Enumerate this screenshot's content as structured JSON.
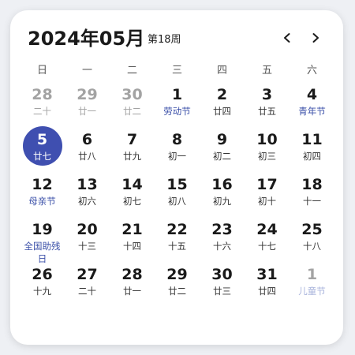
{
  "header": {
    "title": "2024年05月",
    "week": "第18周"
  },
  "weekdays": [
    "日",
    "一",
    "二",
    "三",
    "四",
    "五",
    "六"
  ],
  "weeks": [
    [
      {
        "day": "28",
        "lunar": "二十",
        "other": true
      },
      {
        "day": "29",
        "lunar": "廿一",
        "other": true
      },
      {
        "day": "30",
        "lunar": "廿二",
        "other": true
      },
      {
        "day": "1",
        "lunar": "劳动节",
        "festival": true
      },
      {
        "day": "2",
        "lunar": "廿四"
      },
      {
        "day": "3",
        "lunar": "廿五"
      },
      {
        "day": "4",
        "lunar": "青年节",
        "festival": true
      }
    ],
    [
      {
        "day": "5",
        "lunar": "廿七",
        "today": true
      },
      {
        "day": "6",
        "lunar": "廿八"
      },
      {
        "day": "7",
        "lunar": "廿九"
      },
      {
        "day": "8",
        "lunar": "初一"
      },
      {
        "day": "9",
        "lunar": "初二"
      },
      {
        "day": "10",
        "lunar": "初三"
      },
      {
        "day": "11",
        "lunar": "初四"
      }
    ],
    [
      {
        "day": "12",
        "lunar": "母亲节",
        "festival": true
      },
      {
        "day": "13",
        "lunar": "初六"
      },
      {
        "day": "14",
        "lunar": "初七"
      },
      {
        "day": "15",
        "lunar": "初八"
      },
      {
        "day": "16",
        "lunar": "初九"
      },
      {
        "day": "17",
        "lunar": "初十"
      },
      {
        "day": "18",
        "lunar": "十一"
      }
    ],
    [
      {
        "day": "19",
        "lunar": "全国助残日",
        "festival": true
      },
      {
        "day": "20",
        "lunar": "十三"
      },
      {
        "day": "21",
        "lunar": "十四"
      },
      {
        "day": "22",
        "lunar": "十五"
      },
      {
        "day": "23",
        "lunar": "十六"
      },
      {
        "day": "24",
        "lunar": "十七"
      },
      {
        "day": "25",
        "lunar": "十八"
      }
    ],
    [
      {
        "day": "26",
        "lunar": "十九"
      },
      {
        "day": "27",
        "lunar": "二十"
      },
      {
        "day": "28",
        "lunar": "廿一"
      },
      {
        "day": "29",
        "lunar": "廿二"
      },
      {
        "day": "30",
        "lunar": "廿三"
      },
      {
        "day": "31",
        "lunar": "廿四"
      },
      {
        "day": "1",
        "lunar": "儿童节",
        "festival": true,
        "other": true
      }
    ]
  ],
  "colors": {
    "accent": "#3f4fb0",
    "festival": "#3a4fa8",
    "muted": "#a3a3a3"
  },
  "icons": {
    "prev": "chevron-left-icon",
    "next": "chevron-right-icon"
  }
}
